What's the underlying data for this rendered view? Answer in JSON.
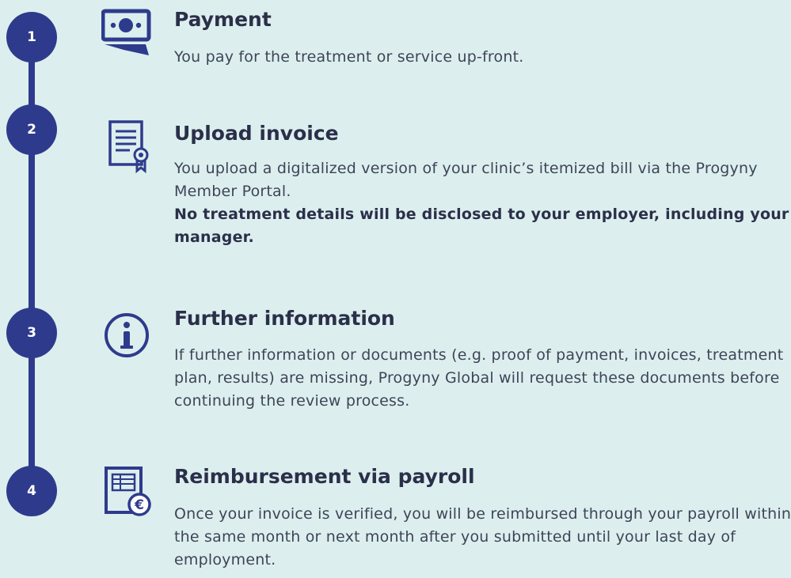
{
  "colors": {
    "background": "#dcefee",
    "accent": "#2e3b8c",
    "title_text": "#2b2f4a",
    "body_text": "#3f4458"
  },
  "steps": [
    {
      "number": "1",
      "icon": "money-icon",
      "title": "Payment",
      "body": "You pay for the treatment or service up-front.",
      "note": ""
    },
    {
      "number": "2",
      "icon": "invoice-certificate-icon",
      "title": "Upload invoice",
      "body": "You upload a digitalized version of your clinic’s itemized bill via the Progyny Member Portal.",
      "note": "No treatment details will be disclosed to your employer, including your manager."
    },
    {
      "number": "3",
      "icon": "info-icon",
      "title": "Further information",
      "body": "If further information or documents (e.g. proof of payment, invoices, treatment plan, results) are missing, Progyny Global will request these documents before continuing the review process.",
      "note": ""
    },
    {
      "number": "4",
      "icon": "euro-invoice-icon",
      "title": "Reimbursement via payroll",
      "body": "Once your invoice is verified, you will be reimbursed through your payroll within the same month or next month after you submitted until your last day of employment.",
      "note": ""
    }
  ]
}
